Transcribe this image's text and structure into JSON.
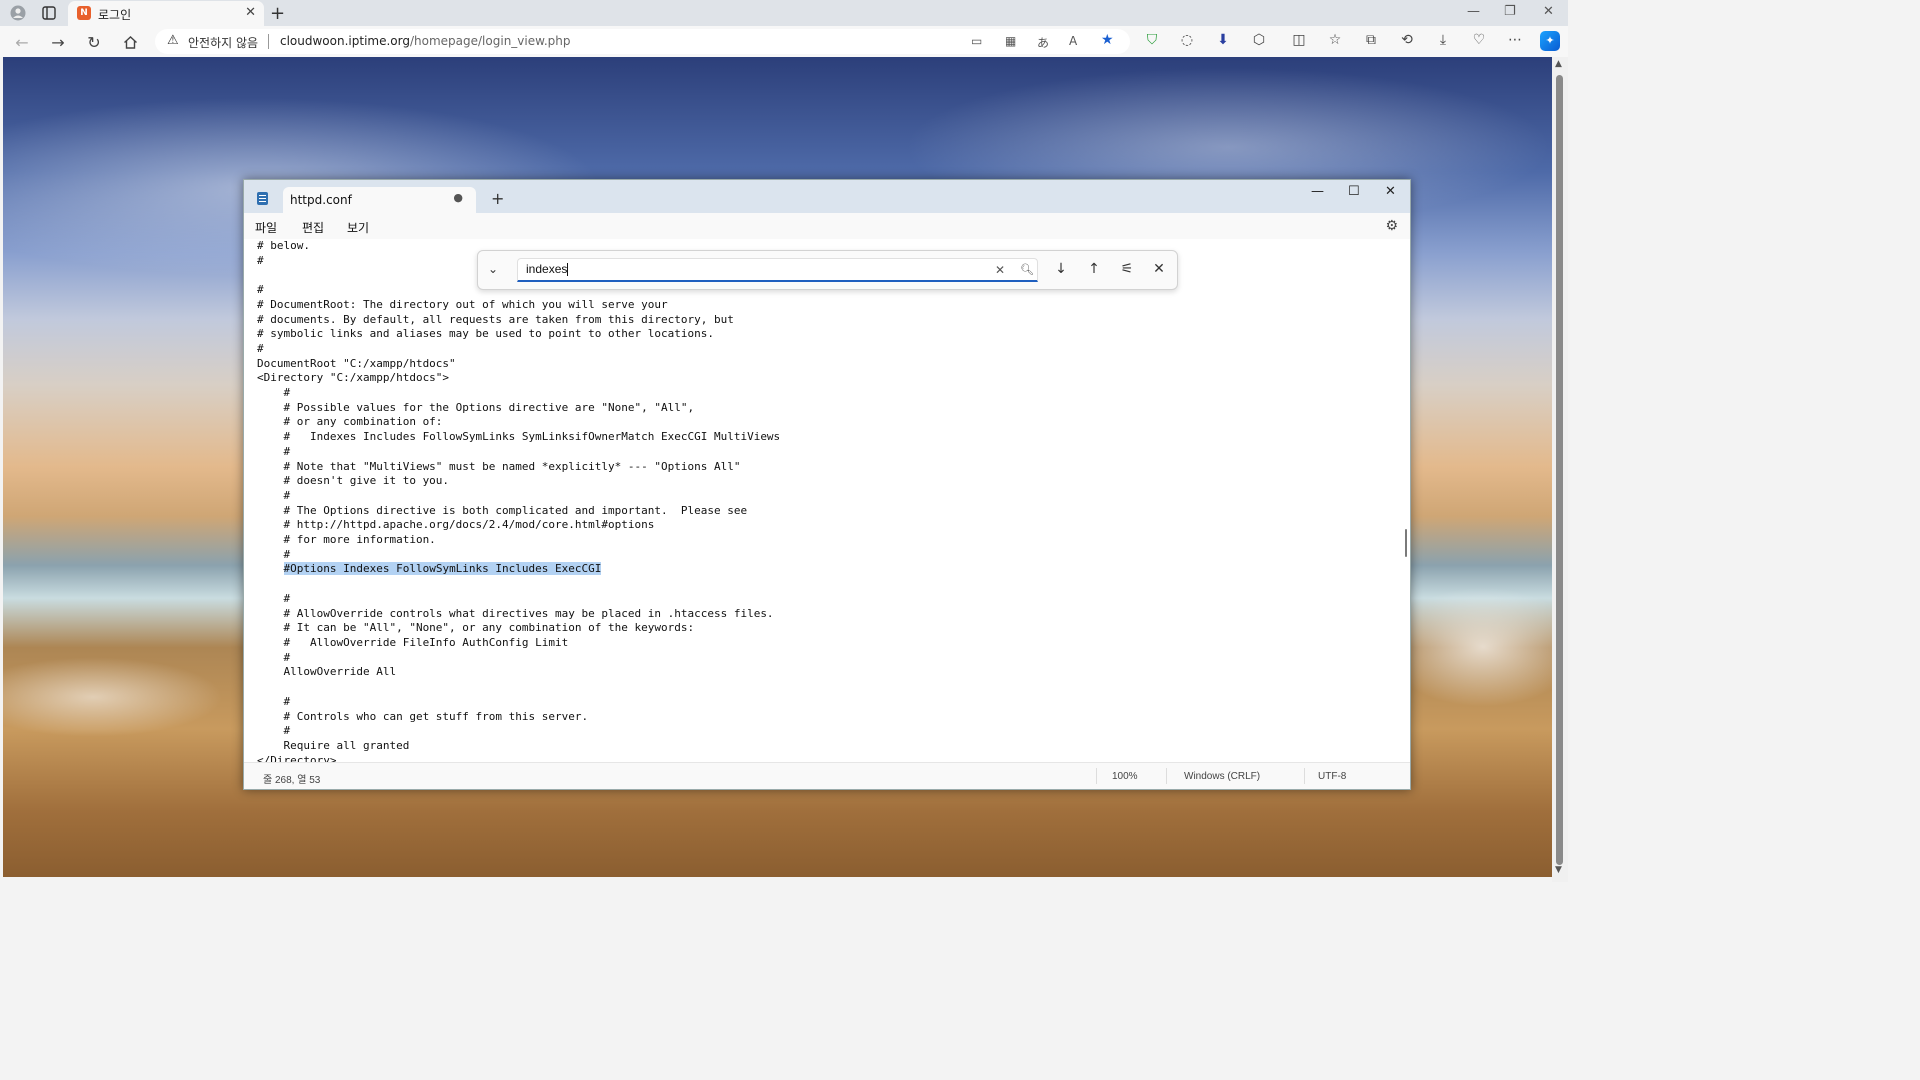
{
  "browser": {
    "tab_title": "로그인",
    "tab_favicon": "N",
    "address": {
      "security_label": "안전하지 않음",
      "url_host": "cloudwoon.iptime.org",
      "url_path": "/homepage/login_view.php"
    }
  },
  "notepad": {
    "tab_title": "httpd.conf",
    "tab_unsaved_dot": "●",
    "menu": {
      "file": "파일",
      "edit": "편집",
      "view": "보기"
    },
    "lines": [
      "# below.",
      "#",
      "",
      "#",
      "# DocumentRoot: The directory out of which you will serve your",
      "# documents. By default, all requests are taken from this directory, but",
      "# symbolic links and aliases may be used to point to other locations.",
      "#",
      "DocumentRoot \"C:/xampp/htdocs\"",
      "<Directory \"C:/xampp/htdocs\">",
      "    #",
      "    # Possible values for the Options directive are \"None\", \"All\",",
      "    # or any combination of:",
      "    #   Indexes Includes FollowSymLinks SymLinksifOwnerMatch ExecCGI MultiViews",
      "    #",
      "    # Note that \"MultiViews\" must be named *explicitly* --- \"Options All\"",
      "    # doesn't give it to you.",
      "    #",
      "    # The Options directive is both complicated and important.  Please see",
      "    # http://httpd.apache.org/docs/2.4/mod/core.html#options",
      "    # for more information.",
      "    #",
      "    #Options Indexes FollowSymLinks Includes ExecCGI",
      "",
      "    #",
      "    # AllowOverride controls what directives may be placed in .htaccess files.",
      "    # It can be \"All\", \"None\", or any combination of the keywords:",
      "    #   AllowOverride FileInfo AuthConfig Limit",
      "    #",
      "    AllowOverride All",
      "",
      "    #",
      "    # Controls who can get stuff from this server.",
      "    #",
      "    Require all granted",
      "</Directory>"
    ],
    "highlight_line_index": 22,
    "highlight_text": "#Options Indexes FollowSymLinks Includes ExecCGI",
    "find": {
      "query": "indexes"
    },
    "status": {
      "position": "줄 268, 열 53",
      "zoom": "100%",
      "line_ending": "Windows (CRLF)",
      "encoding": "UTF-8"
    }
  },
  "icons": {
    "profile": "person-icon",
    "tab_actions": "tab-actions-icon",
    "back": "back-arrow-icon",
    "forward": "forward-arrow-icon",
    "refresh": "refresh-icon",
    "home": "home-icon",
    "favorite": "star-filled-icon",
    "copilot": "copilot-icon",
    "notepad": "notepad-app-icon",
    "settings": "gear-icon"
  },
  "colors": {
    "highlight": "#b3d2f3",
    "find_underline": "#1f5fbf",
    "favorite_star": "#1a5fd1",
    "favicon": "#e8602c"
  }
}
